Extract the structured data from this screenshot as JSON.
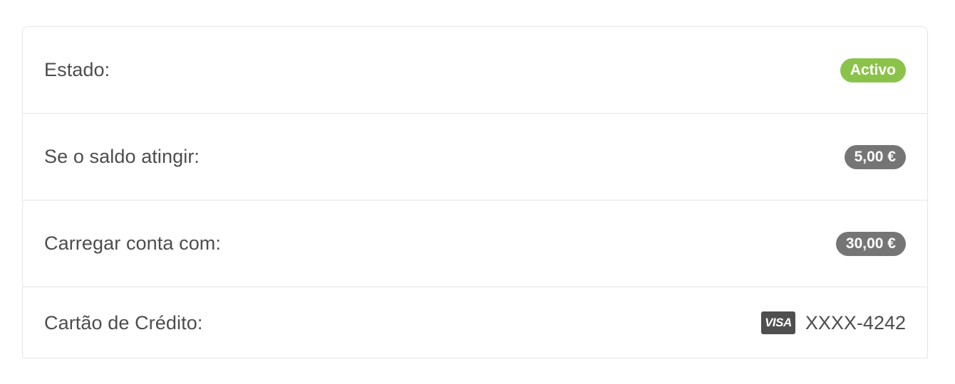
{
  "settings": {
    "rows": [
      {
        "label": "Estado:",
        "value": "Activo",
        "value_color": "#8bc34a"
      },
      {
        "label": "Se o saldo atingir:",
        "value": "5,00 €",
        "value_color": "#757575"
      },
      {
        "label": "Carregar conta com:",
        "value": "30,00 €",
        "value_color": "#757575"
      },
      {
        "label": "Cartão de Crédito:",
        "card_brand": "VISA",
        "card_number": "XXXX-4242",
        "icon": "visa-card-icon"
      }
    ]
  }
}
